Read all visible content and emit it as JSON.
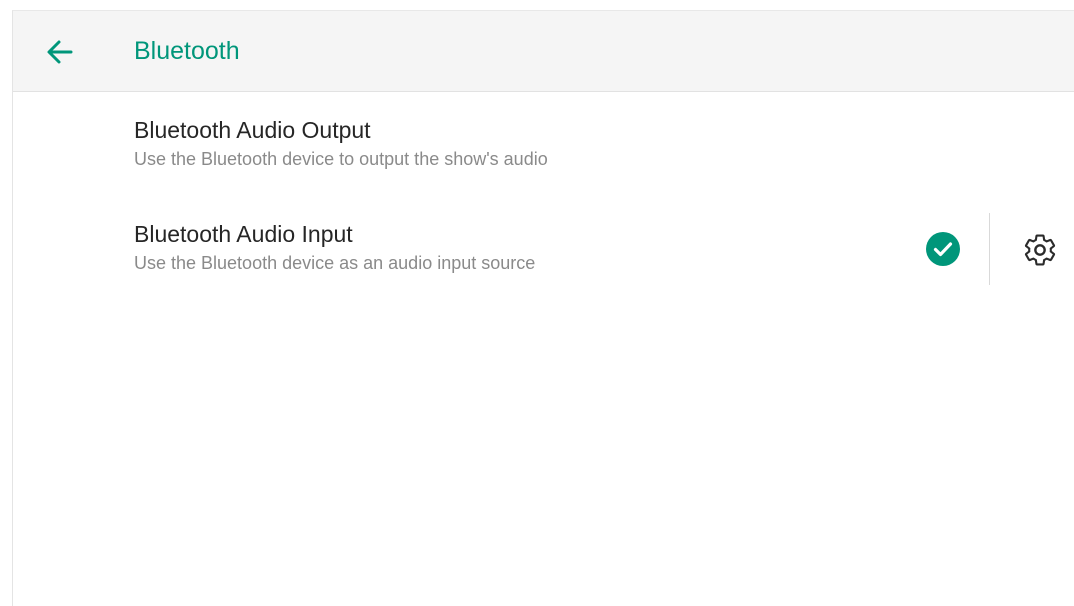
{
  "header": {
    "title": "Bluetooth",
    "back_icon": "arrow-left-icon"
  },
  "settings": [
    {
      "title": "Bluetooth Audio Output",
      "subtitle": "Use the Bluetooth device to output the show's audio",
      "selected": false
    },
    {
      "title": "Bluetooth Audio Input",
      "subtitle": "Use the Bluetooth device as an audio input source",
      "selected": true,
      "status_icon": "check-circle-icon",
      "settings_icon": "gear-icon"
    }
  ],
  "colors": {
    "accent": "#00967a",
    "header_bg": "#f5f5f5",
    "title_text": "#262626",
    "subtitle_text": "#8a8a8a"
  }
}
